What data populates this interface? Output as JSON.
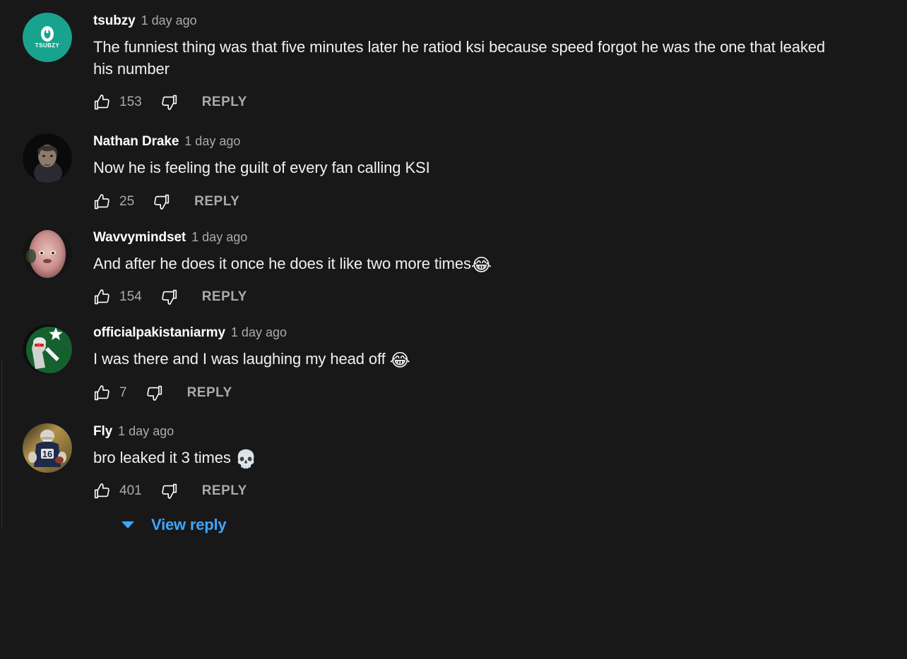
{
  "theme": {
    "background": "#181818",
    "text_primary": "#f1f1f1",
    "text_secondary": "#aaaaaa",
    "link_blue": "#3ea6ff"
  },
  "comments": [
    {
      "author": "tsubzy",
      "timestamp": "1 day ago",
      "text": "The funniest thing was that five minutes later he ratiod ksi because speed forgot he was the one that leaked his number",
      "emoji": "",
      "likes": "153",
      "reply_label": "REPLY",
      "avatar_name": "avatar-tsubzy"
    },
    {
      "author": "Nathan Drake",
      "timestamp": "1 day ago",
      "text": "Now he is feeling the guilt of every fan calling KSI",
      "emoji": "",
      "likes": "25",
      "reply_label": "REPLY",
      "avatar_name": "avatar-nathan-drake"
    },
    {
      "author": "Wavvymindset",
      "timestamp": "1 day ago",
      "text": "And after he does it once he does it like two more times",
      "emoji": "😂",
      "likes": "154",
      "reply_label": "REPLY",
      "avatar_name": "avatar-wavvymindset"
    },
    {
      "author": "officialpakistaniarmy",
      "timestamp": "1 day ago",
      "text": "I was there  and I was laughing my head off ",
      "emoji": "😂",
      "likes": "7",
      "reply_label": "REPLY",
      "avatar_name": "avatar-officialpakistaniarmy"
    },
    {
      "author": "Fly",
      "timestamp": "1 day ago",
      "text": "bro leaked it 3 times ",
      "emoji": "💀",
      "likes": "401",
      "reply_label": "REPLY",
      "avatar_name": "avatar-fly"
    }
  ],
  "view_replies": {
    "label": "View reply",
    "icon": "chevron-down-icon"
  },
  "icons": {
    "like": "thumbs-up-icon",
    "dislike": "thumbs-down-icon"
  }
}
